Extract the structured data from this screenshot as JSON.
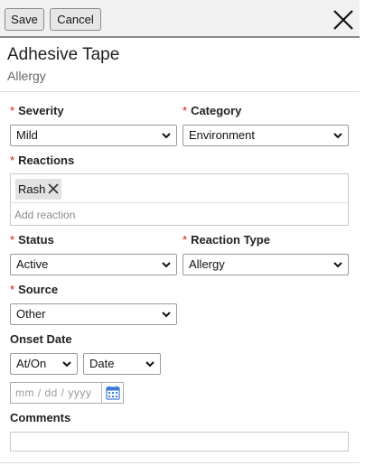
{
  "toolbar": {
    "save_label": "Save",
    "cancel_label": "Cancel"
  },
  "header": {
    "title": "Adhesive Tape",
    "subtitle": "Allergy"
  },
  "form": {
    "required_marker": "*",
    "severity": {
      "label": "Severity",
      "value": "Mild"
    },
    "category": {
      "label": "Category",
      "value": "Environment"
    },
    "reactions": {
      "label": "Reactions",
      "chips": [
        "Rash"
      ],
      "placeholder": "Add reaction"
    },
    "status": {
      "label": "Status",
      "value": "Active"
    },
    "reaction_type": {
      "label": "Reaction Type",
      "value": "Allergy"
    },
    "source": {
      "label": "Source",
      "value": "Other"
    },
    "onset_date": {
      "label": "Onset Date",
      "qualifier": "At/On",
      "precision": "Date",
      "placeholder": "mm /  dd  /  yyyy"
    },
    "comments": {
      "label": "Comments",
      "value": ""
    }
  },
  "colors": {
    "required": "#dd1111",
    "calendar_icon": "#3a7bd5",
    "toolbar_bg": "#f1f1f1"
  },
  "icons": {
    "close": "close-icon",
    "chevron": "chevron-down-icon",
    "chip_remove": "remove-icon",
    "calendar": "calendar-icon"
  }
}
